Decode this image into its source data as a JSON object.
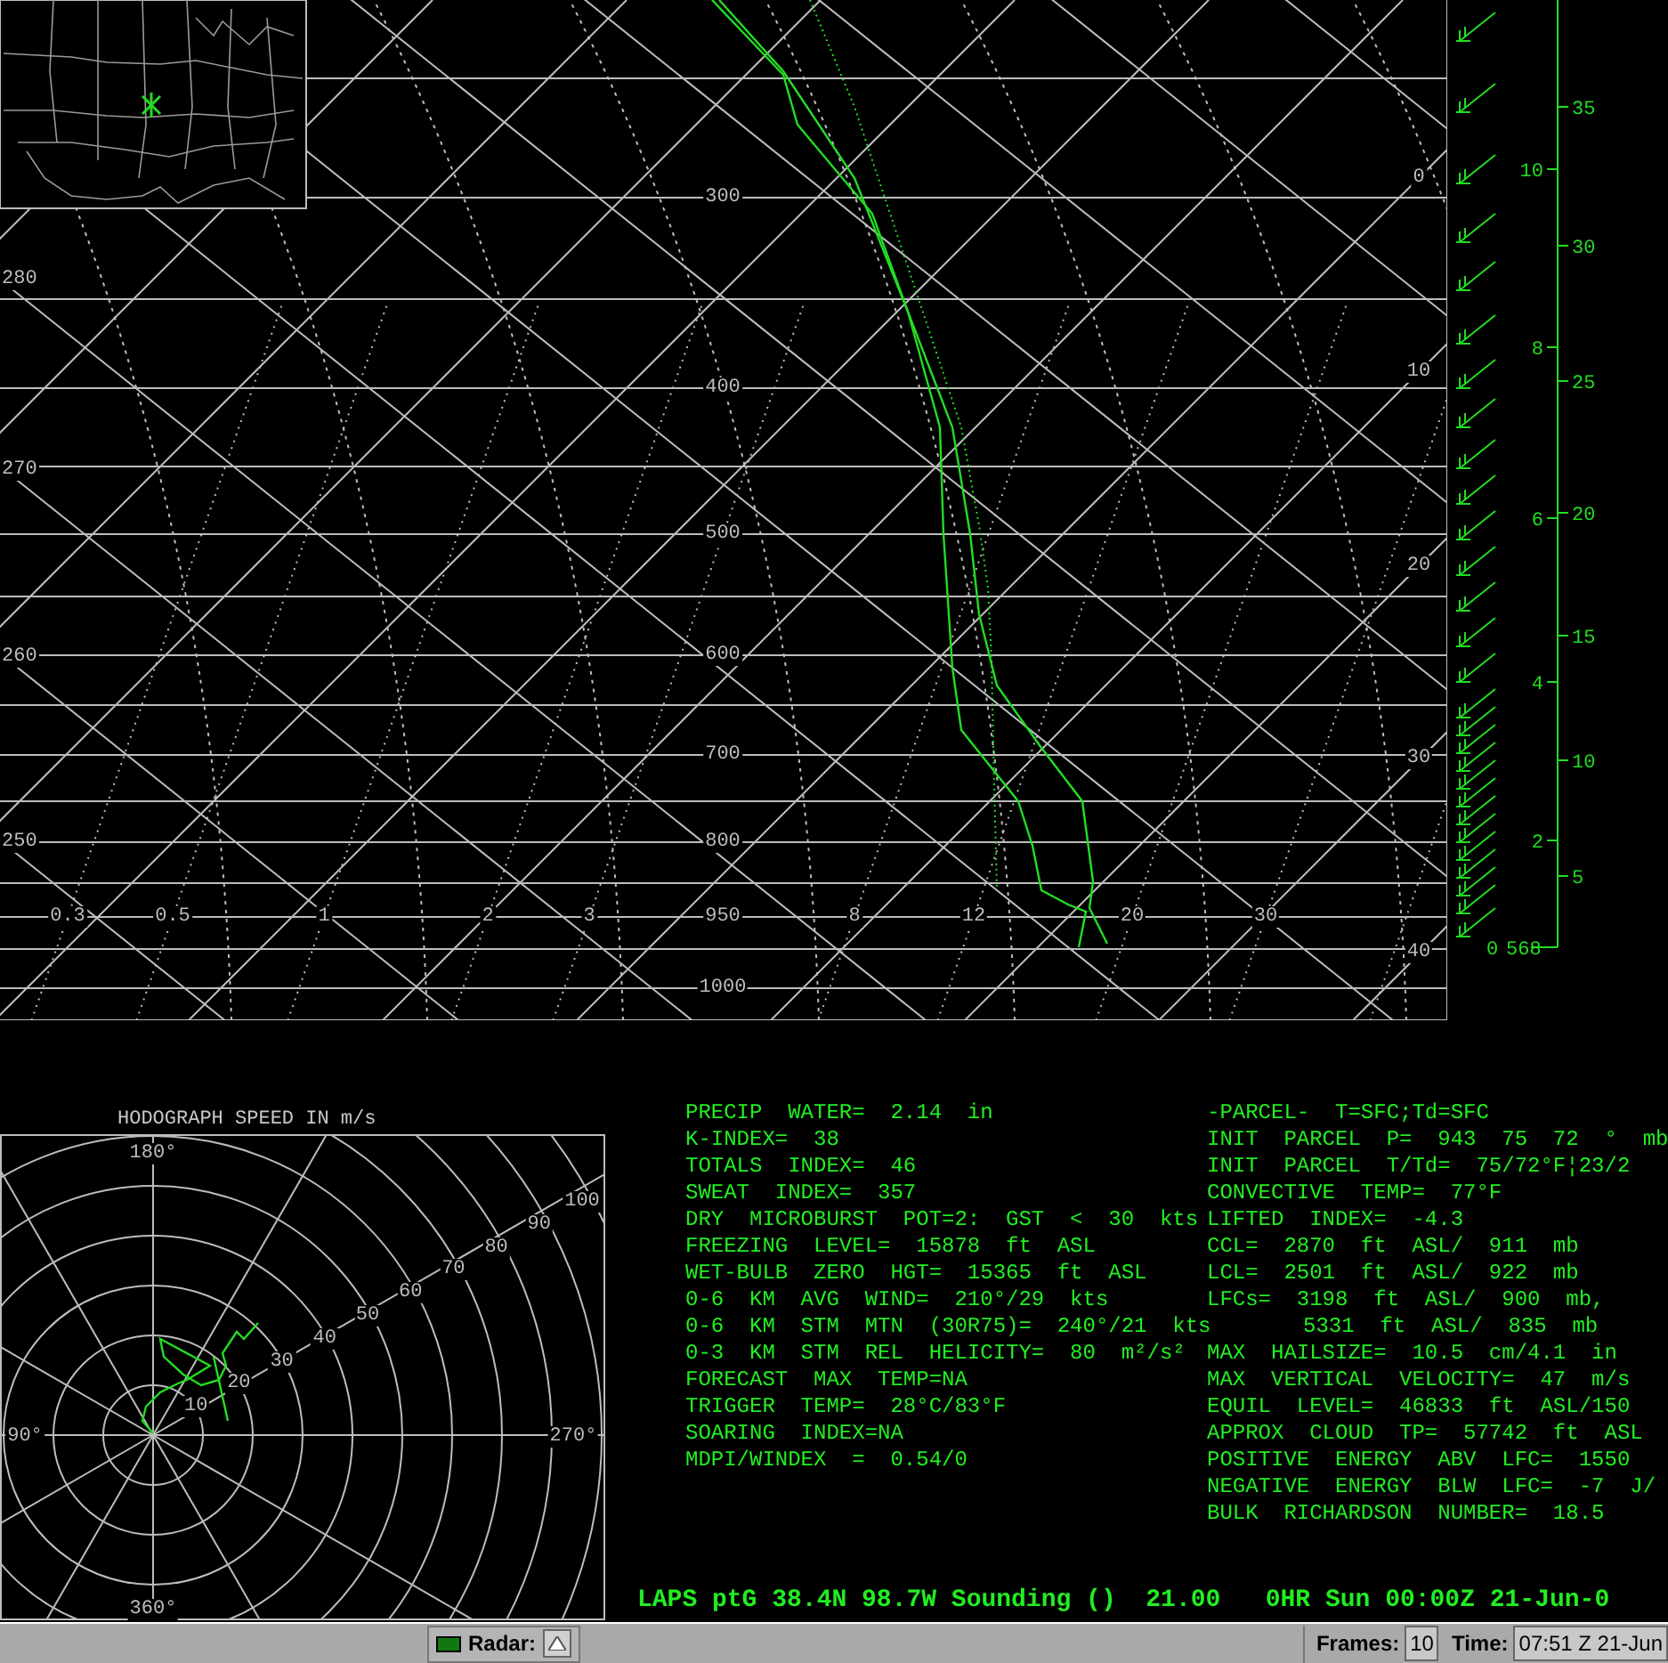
{
  "skewt": {
    "pressure_labels": [
      "300",
      "400",
      "500",
      "600",
      "700",
      "800",
      "950",
      "1000"
    ],
    "theta_labels": [
      "280",
      "270",
      "260",
      "250"
    ],
    "mixing_ratio_labels": [
      "0.3",
      "0.5",
      "1",
      "2",
      "3",
      "8",
      "12",
      "20",
      "30"
    ],
    "temperature_labels": [
      "0",
      "10",
      "20",
      "30",
      "40"
    ]
  },
  "height_axis": {
    "km_labels": [
      "10",
      "8",
      "6",
      "4",
      "2"
    ],
    "kft_labels": [
      "35",
      "30",
      "25",
      "20",
      "15",
      "10",
      "5"
    ],
    "surface_labels": [
      "0",
      "568"
    ]
  },
  "hodograph": {
    "title": "HODOGRAPH SPEED IN m/s",
    "direction_labels": [
      "180°",
      "90°",
      "270°",
      "360°"
    ],
    "speed_labels": [
      "10",
      "20",
      "30",
      "40",
      "50",
      "60",
      "70",
      "80",
      "90",
      "100"
    ]
  },
  "indices_left": [
    {
      "text": "PRECIP  WATER=  2.14  in"
    },
    {
      "text": "K-INDEX=  38"
    },
    {
      "text": "TOTALS  INDEX=  46"
    },
    {
      "text": "SWEAT  INDEX=  357"
    },
    {
      "text": "DRY  MICROBURST  POT=2:  GST  <  30  kts"
    },
    {
      "text": "FREEZING  LEVEL=  15878  ft  ASL"
    },
    {
      "text": "WET-BULB  ZERO  HGT=  15365  ft  ASL"
    },
    {
      "text": "0-6  KM  AVG  WIND=  210°/29  kts"
    },
    {
      "text": "0-6  KM  STM  MTN  (30R75)=  240°/21  kts"
    },
    {
      "text": "0-3  KM  STM  REL  HELICITY=  80  m²/s²"
    },
    {
      "text": "FORECAST  MAX  TEMP=NA"
    },
    {
      "text": "TRIGGER  TEMP=  28°C/83°F"
    },
    {
      "text": "SOARING  INDEX=NA"
    },
    {
      "text": "MDPI/WINDEX  =  0.54/0"
    }
  ],
  "indices_right": [
    {
      "kind": "line",
      "text": "-PARCEL-  T=SFC;Td=SFC"
    },
    {
      "kind": "line",
      "text": "INIT  PARCEL  P=  943  75  72  °  mb"
    },
    {
      "kind": "line",
      "text": "INIT  PARCEL  T/Td=  75/72°F¦23/2"
    },
    {
      "kind": "line",
      "text": "CONVECTIVE  TEMP=  77°F"
    },
    {
      "kind": "line",
      "text": "LIFTED  INDEX=  -4.3"
    },
    {
      "kind": "line",
      "text": "CCL=  2870  ft  ASL/  911  mb"
    },
    {
      "kind": "line",
      "text": "LCL=  2501  ft  ASL/  922  mb"
    },
    {
      "kind": "line",
      "text": "LFCs=  3198  ft  ASL/  900  mb,"
    },
    {
      "kind": "continuation",
      "text": "5331  ft  ASL/  835  mb"
    },
    {
      "kind": "line",
      "text": "MAX  HAILSIZE=  10.5  cm/4.1  in"
    },
    {
      "kind": "line",
      "text": "MAX  VERTICAL  VELOCITY=  47  m/s"
    },
    {
      "kind": "line",
      "text": "EQUIL  LEVEL=  46833  ft  ASL/150"
    },
    {
      "kind": "line",
      "text": "APPROX  CLOUD  TP=  57742  ft  ASL"
    },
    {
      "kind": "line",
      "text": "POSITIVE  ENERGY  ABV  LFC=  1550"
    },
    {
      "kind": "line",
      "text": "NEGATIVE  ENERGY  BLW  LFC=  -7  J/"
    },
    {
      "kind": "line",
      "text": "BULK  RICHARDSON  NUMBER=  18.5"
    }
  ],
  "title_line": "LAPS ptG 38.4N 98.7W Sounding ()  21.00   0HR Sun 00:00Z 21-Jun-0",
  "status_bar": {
    "radar_label": "Radar:",
    "frames_label": "Frames:",
    "frames_value": "10",
    "time_label": "Time:",
    "time_value": "07:51 Z 21-Jun"
  }
}
